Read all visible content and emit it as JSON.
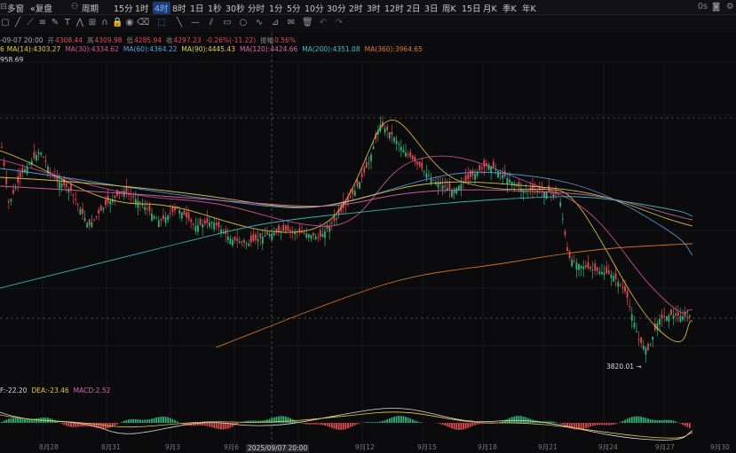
{
  "toolbar": {
    "items": [
      "多窗",
      "复盘",
      "周期",
      "15分",
      "1时",
      "4时",
      "8时",
      "1日",
      "1秒",
      "30秒",
      "分时",
      "1分",
      "5分",
      "10分",
      "30分",
      "2时",
      "3时",
      "12时",
      "2日",
      "3日",
      "周K",
      "15日",
      "月K",
      "季K",
      "年K"
    ],
    "active": "4时",
    "right": "0s"
  },
  "ohlc": {
    "date": "-09-07 20:00",
    "open_label": "开",
    "open": "4308.44",
    "high_label": "高",
    "high": "4309.98",
    "low_label": "低",
    "low": "4285.94",
    "close_label": "收",
    "close": "4297.23",
    "change": "-0.26%(-11.22)",
    "amp_label": "振幅",
    "amp": "0.56%"
  },
  "ma": [
    {
      "label": "MA(14):4303.27",
      "color": "#e6c84a"
    },
    {
      "label": "MA(30):4334.62",
      "color": "#d0559a"
    },
    {
      "label": "MA(60):4364.22",
      "color": "#5aa0e6"
    },
    {
      "label": "MA(90):4445.43",
      "color": "#e0d25a"
    },
    {
      "label": "MA(120):4424.66",
      "color": "#d86aa8"
    },
    {
      "label": "MA(200):4351.08",
      "color": "#3ec2c2"
    },
    {
      "label": "MA(360):3964.65",
      "color": "#e07a2a"
    }
  ],
  "ma_prefix": "6",
  "price_marker": "958.69",
  "low_marker": "3820.01",
  "macd": {
    "dif": "F:-22.20",
    "dea": "DEA:-23.46",
    "macd": "MACD:2.52"
  },
  "x_axis": [
    "8月28",
    "8月31",
    "9月3",
    "9月6",
    "2025/09/07 20:00",
    "9月12",
    "9月15",
    "9月18",
    "9月21",
    "9月24",
    "9月27",
    "9月30"
  ],
  "colors": {
    "up": "#2fb37a",
    "down": "#e04a50",
    "grid": "#1d1d22"
  }
}
